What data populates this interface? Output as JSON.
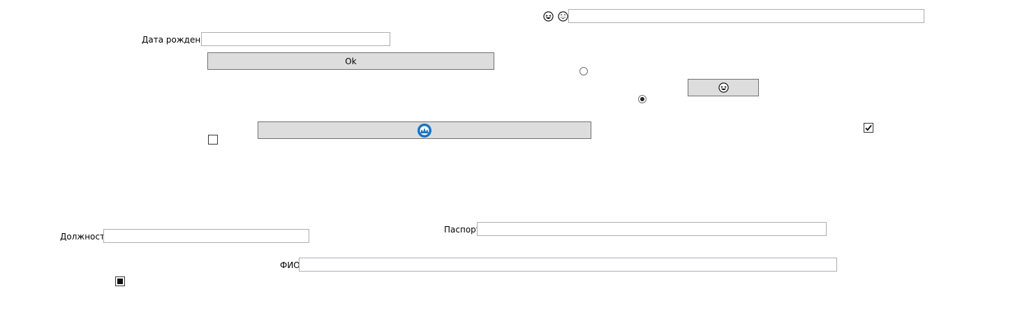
{
  "top": {
    "emoji_1": "grinning-squint-icon",
    "emoji_2": "smile-icon",
    "input_value": ""
  },
  "birthdate": {
    "label": "Дата рождения",
    "value": ""
  },
  "ok_button": {
    "label": "Ok"
  },
  "emoji_button": {
    "icon": "grinning-squint-icon"
  },
  "icon_button": {
    "icon": "blue-round-icon"
  },
  "radios": [
    {
      "name": "radio-1",
      "checked": false
    },
    {
      "name": "radio-2",
      "checked": true
    }
  ],
  "checkboxes": [
    {
      "name": "checkbox-1",
      "state": "unchecked"
    },
    {
      "name": "checkbox-2",
      "state": "checked"
    },
    {
      "name": "checkbox-3",
      "state": "indeterminate"
    }
  ],
  "position_field": {
    "label": "Должность",
    "value": ""
  },
  "passport_field": {
    "label": "Паспорт",
    "value": ""
  },
  "fio_field": {
    "label": "ФИО",
    "value": ""
  },
  "colors": {
    "button_bg": "#dddddd",
    "border": "#abadb3",
    "accent": "#1a73c2"
  }
}
